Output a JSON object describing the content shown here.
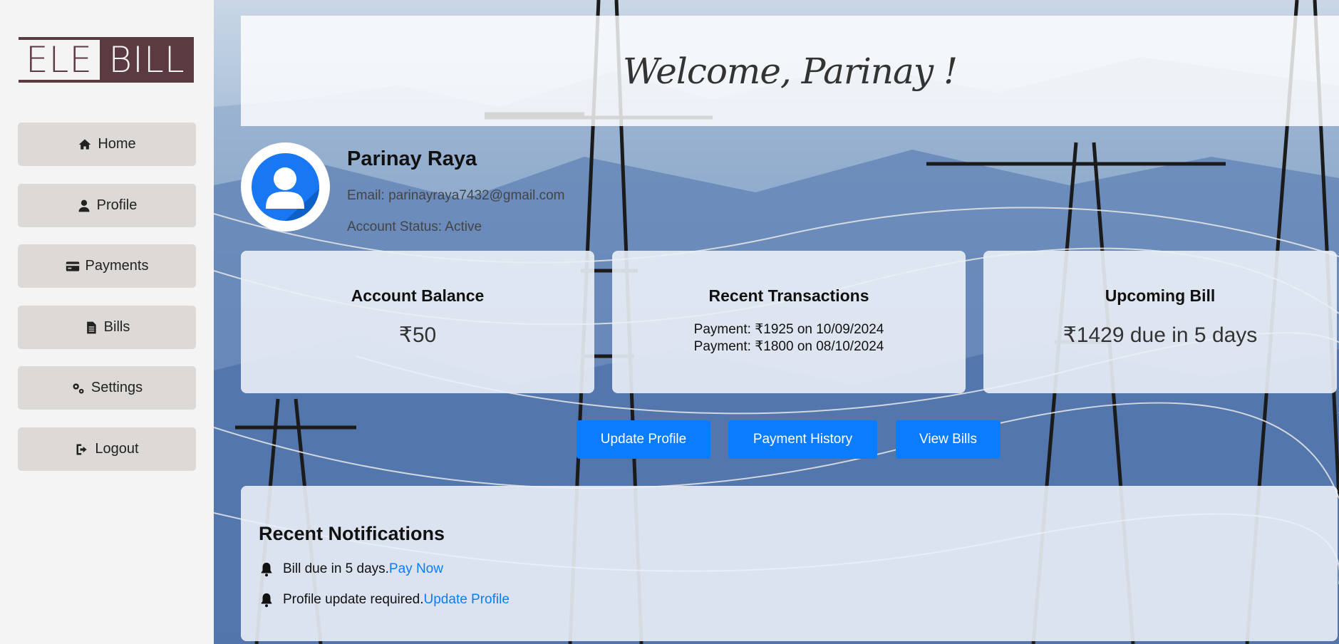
{
  "brand": {
    "logo_left": "ELE",
    "logo_right": "BILL"
  },
  "sidebar": {
    "items": [
      {
        "label": "Home",
        "icon": "home-icon"
      },
      {
        "label": "Profile",
        "icon": "user-icon"
      },
      {
        "label": "Payments",
        "icon": "credit-card-icon"
      },
      {
        "label": "Bills",
        "icon": "file-invoice-icon"
      },
      {
        "label": "Settings",
        "icon": "gears-icon"
      },
      {
        "label": "Logout",
        "icon": "sign-out-icon"
      }
    ]
  },
  "header": {
    "welcome": "Welcome, Parinay !"
  },
  "profile": {
    "name": "Parinay Raya",
    "email": "Email: parinayraya7432@gmail.com",
    "status": "Account Status: Active"
  },
  "cards": {
    "balance": {
      "title": "Account Balance",
      "value": "₹50"
    },
    "transactions": {
      "title": "Recent Transactions",
      "lines": [
        "Payment: ₹1925 on 10/09/2024",
        "Payment: ₹1800 on 08/10/2024"
      ]
    },
    "upcoming": {
      "title": "Upcoming Bill",
      "value": "₹1429 due in 5 days"
    }
  },
  "actions": {
    "update_profile": "Update Profile",
    "payment_history": "Payment History",
    "view_bills": "View Bills"
  },
  "notifications": {
    "title": "Recent Notifications",
    "items": [
      {
        "text": "Bill due in 5 days.",
        "link": "Pay Now"
      },
      {
        "text": "Profile update required.",
        "link": "Update Profile"
      }
    ]
  },
  "colors": {
    "brand": "#5b3a42",
    "accent": "#0a7cff",
    "sidebar_button": "#dcd9d7"
  }
}
